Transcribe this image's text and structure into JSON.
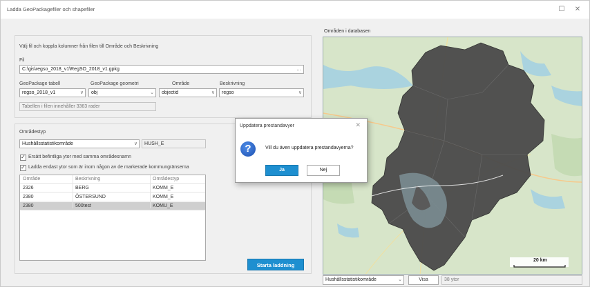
{
  "window": {
    "title": "Ladda GeoPackagefiler och shapefiler",
    "minimize": "☐",
    "close": "✕"
  },
  "left": {
    "instruction": "Välj fil och koppla kolumner från filen till Område och Beskrivning",
    "file_label": "Fil",
    "file_value": "C:\\gis\\regso_2018_v1\\RegSO_2018_v1.gpkg",
    "file_browse": "...",
    "gpkg_table_label": "GeoPackage tabell",
    "gpkg_table_value": "regso_2018_v1",
    "gpkg_geom_label": "GeoPackage geometri",
    "gpkg_geom_value": "obj",
    "omrade_label": "Område",
    "omrade_value": "objectid",
    "beskrivning_label": "Beskrivning",
    "beskrivning_value": "regso",
    "rows_info": "Tabellen i filen innehåller 3363 rader",
    "omradestyp_label": "Områdestyp",
    "omradestyp_value": "Hushållsstatistikområde",
    "omradestyp_code": "HUSH_E",
    "check1": "Ersätt befintliga ytor med samma områdesnamn",
    "check2": "Ladda endast ytor som är inom någon av de markerade kommungränserna",
    "table": {
      "headers": [
        "Område",
        "Beskrivning",
        "Områdestyp"
      ],
      "rows": [
        [
          "2326",
          "BERG",
          "KOMM_E"
        ],
        [
          "2380",
          "ÖSTERSUND",
          "KOMM_E"
        ],
        [
          "2380",
          "500test",
          "KOMU_E"
        ]
      ]
    },
    "start_button": "Starta laddning"
  },
  "right": {
    "map_title": "Områden i databasen",
    "scale_label": "20 km",
    "bottom_select": "Hushållsstatistikområde",
    "show_button": "Visa",
    "count_text": "38 ytor"
  },
  "dialog": {
    "title": "Uppdatera prestandavyer",
    "message": "Vill du även uppdatera prestandavyerna?",
    "yes": "Ja",
    "no": "Nej"
  },
  "colors": {
    "accent": "#1e8fd0",
    "region": "#4a4a4a",
    "water": "#aad3df",
    "land": "#d4e3c9"
  }
}
